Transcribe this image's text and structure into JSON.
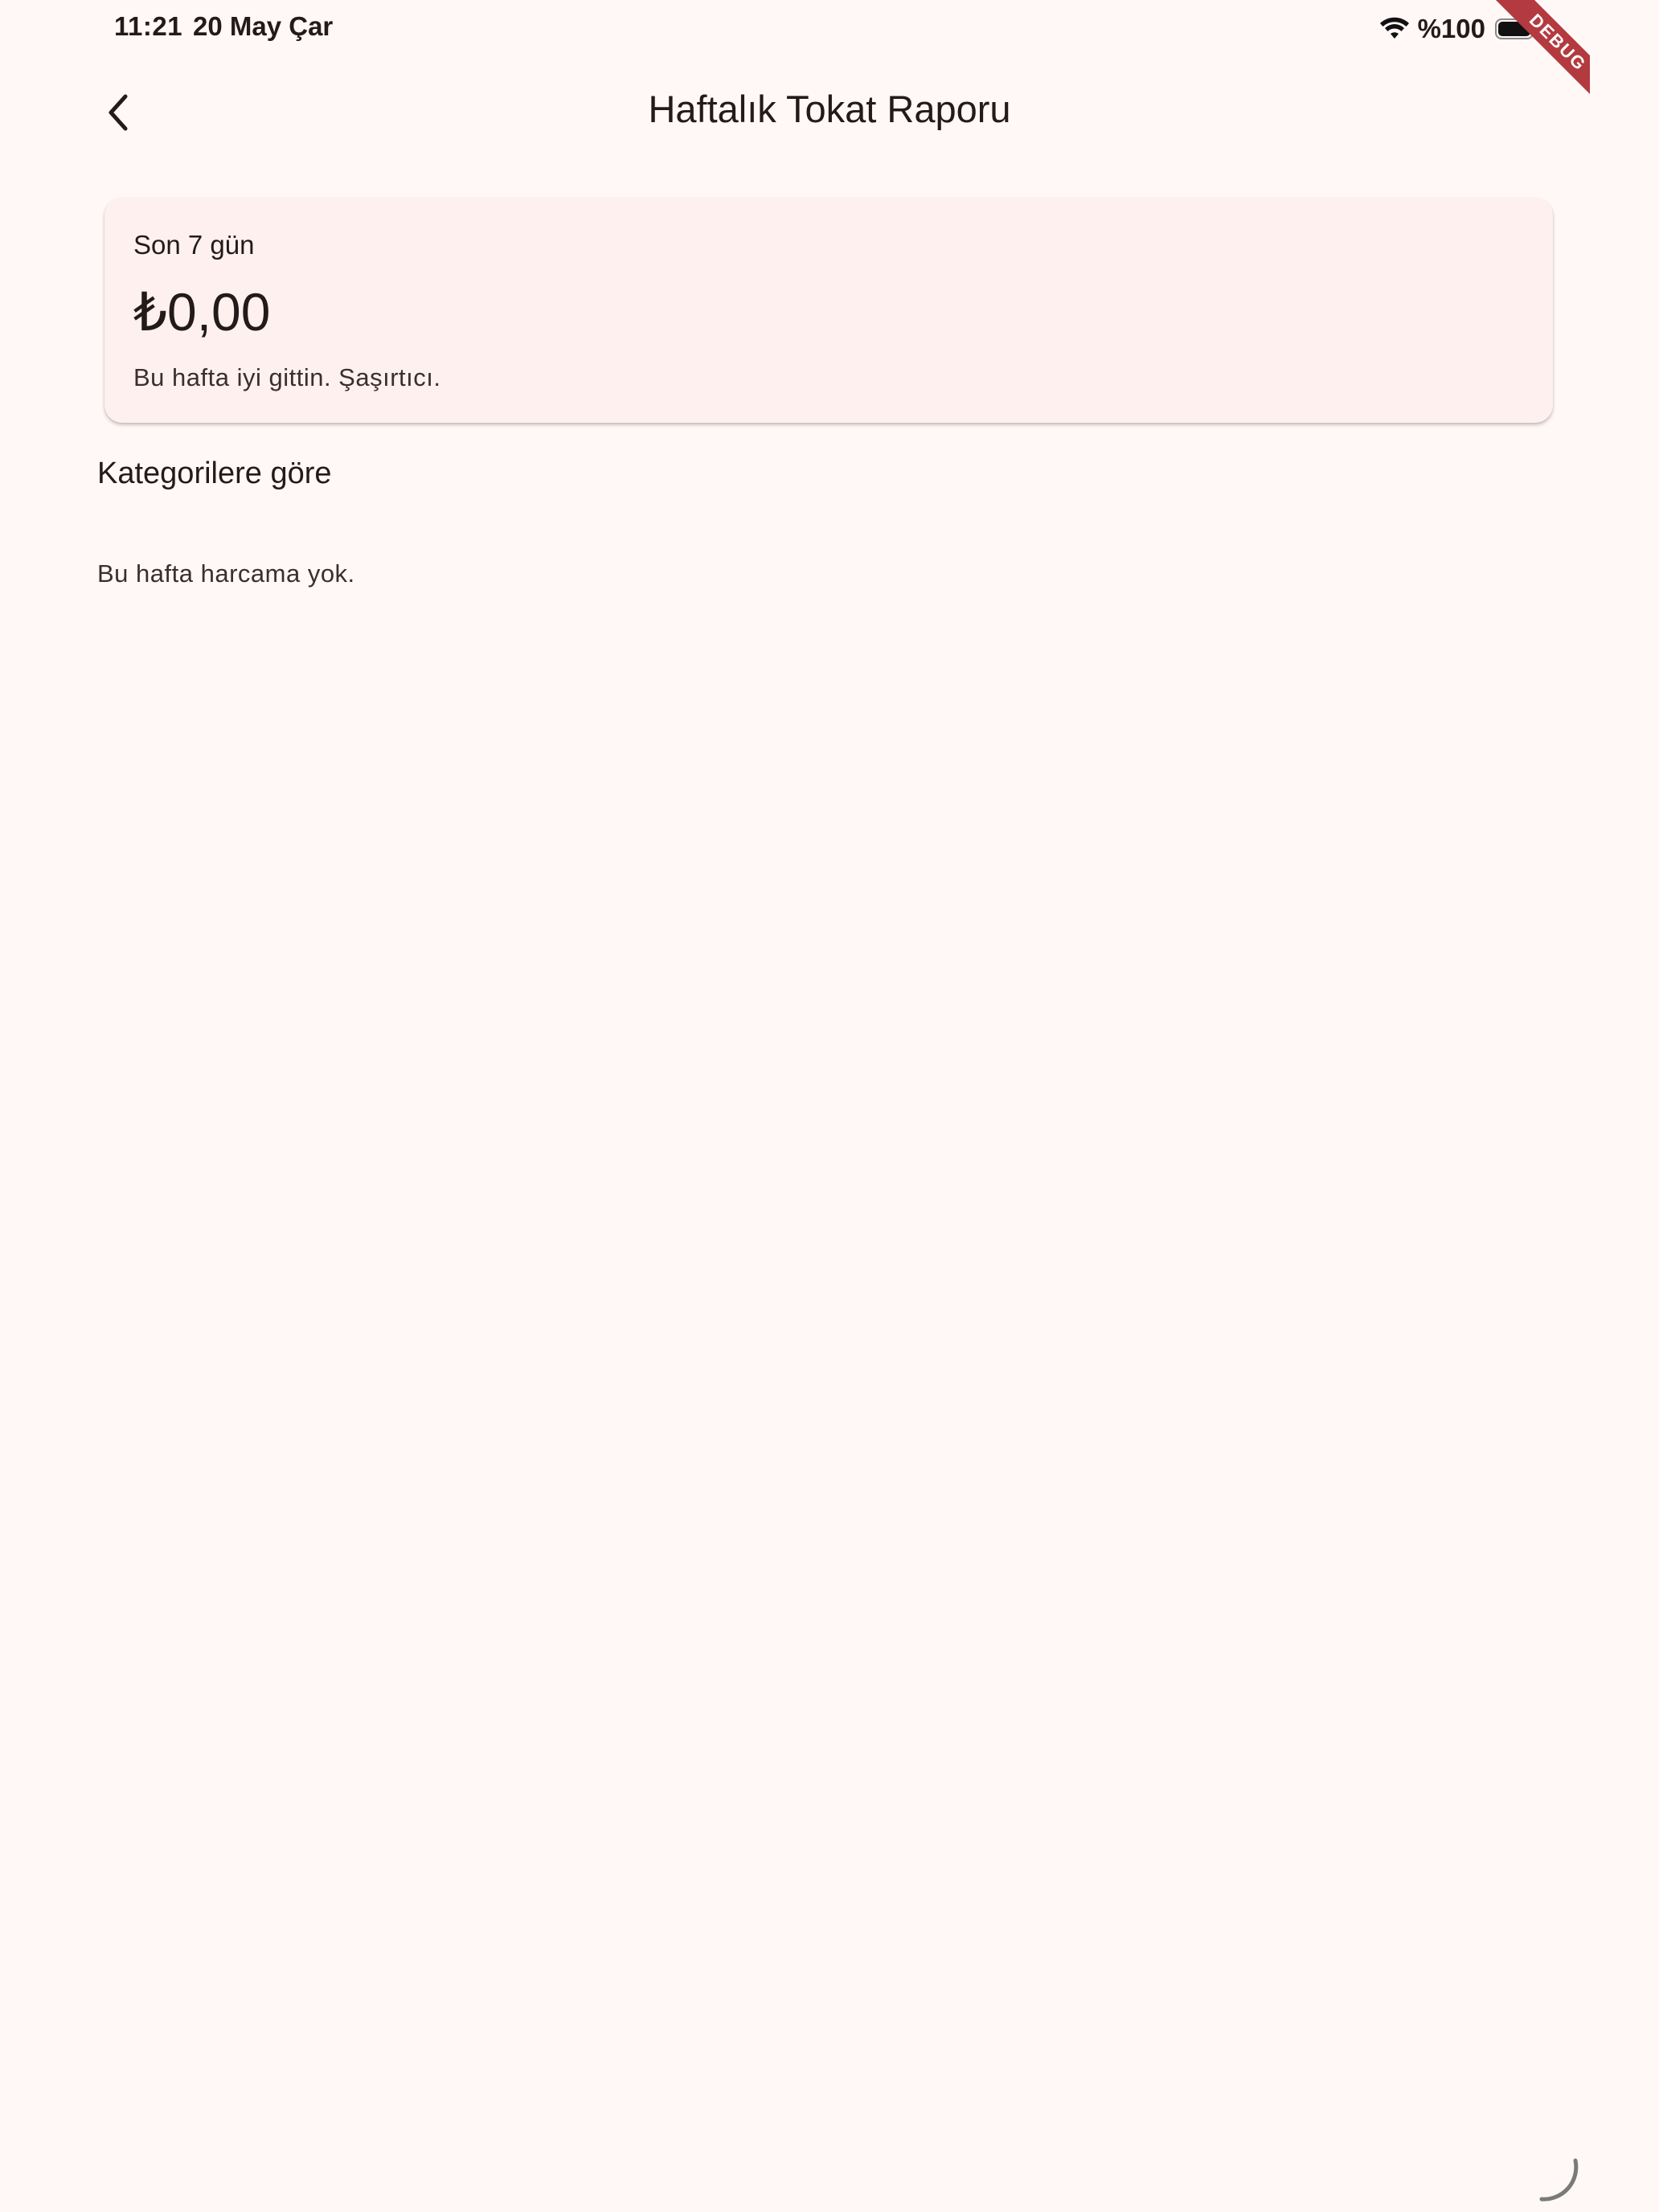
{
  "status_bar": {
    "time": "11:21",
    "date": "20 May Çar",
    "battery": "%100",
    "wifi_icon": "wifi-icon",
    "battery_icon": "battery-icon"
  },
  "debug_banner": {
    "label": "DEBUG",
    "color": "#b33a3f"
  },
  "app_bar": {
    "title": "Haftalık Tokat Raporu",
    "back_icon": "chevron-left-icon"
  },
  "summary_card": {
    "label": "Son 7 gün",
    "amount": "₺0,00",
    "note": "Bu hafta iyi gittin. Şaşırtıcı."
  },
  "categories": {
    "title": "Kategorilere göre",
    "empty_message": "Bu hafta harcama yok."
  },
  "colors": {
    "background": "#fff8f6",
    "card": "#fff0f0",
    "text": "#231a1a"
  }
}
